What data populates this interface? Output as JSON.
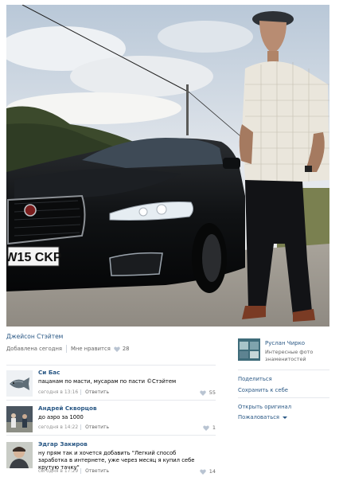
{
  "post": {
    "author": "Джейсон Стэйтем",
    "added": "Добавлена сегодня",
    "like_label": "Мне нравится",
    "like_count": "28"
  },
  "comments": [
    {
      "name": "Си Бас",
      "text": "пацанам по масти, мусарам по пасти ©Стэйтем",
      "time": "сегодня в 13:16",
      "reply": "Ответить",
      "likes": "55",
      "avatar_icon": "fish-avatar"
    },
    {
      "name": "Андрей Скворцов",
      "text": "до аэро за 1000",
      "time": "сегодня в 14:22",
      "reply": "Ответить",
      "likes": "1",
      "avatar_icon": "people-avatar"
    },
    {
      "name": "Эдгар Закиров",
      "text": "ну прям так и хочется добавить \"Легкий способ заработка в интернете, уже через месяц я купил себе крутую тачку\"",
      "time": "сегодня в 17:29",
      "reply": "Ответить",
      "likes": "14",
      "avatar_icon": "person-avatar"
    }
  ],
  "owner": {
    "name": "Руслан Чирко",
    "description": "Интересные фото знаменитостей"
  },
  "actions": {
    "share": "Поделиться",
    "save": "Сохранить к себе",
    "open_original": "Открыть оригинал",
    "report": "Пожаловаться"
  },
  "photo": {
    "plate": "W15 CKP",
    "subject": "man-standing-by-jaguar-car-photo"
  },
  "colors": {
    "link": "#2a5885",
    "muted": "#656565",
    "heart": "#b9c4d2"
  }
}
